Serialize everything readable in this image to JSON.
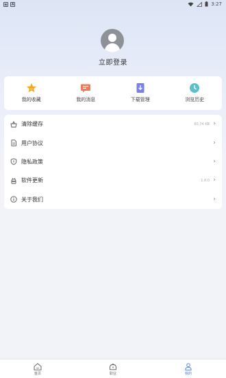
{
  "status_bar": {
    "time": "3:27",
    "left_icons": [
      "notification-icon",
      "a-icon"
    ]
  },
  "profile": {
    "login_label": "立即登录"
  },
  "quick_actions": [
    {
      "label": "我的收藏",
      "icon": "star-icon",
      "color": "#f5a623"
    },
    {
      "label": "我的消息",
      "icon": "message-icon",
      "color": "#ef7a5a"
    },
    {
      "label": "下载管理",
      "icon": "download-icon",
      "color": "#7b7fe8"
    },
    {
      "label": "浏览历史",
      "icon": "history-icon",
      "color": "#5bc0c8"
    }
  ],
  "menu": [
    {
      "label": "清除缓存",
      "icon": "basket-icon",
      "value": "60.74 KB"
    },
    {
      "label": "用户协议",
      "icon": "document-icon",
      "value": ""
    },
    {
      "label": "隐私政策",
      "icon": "shield-icon",
      "value": ""
    },
    {
      "label": "软件更新",
      "icon": "android-icon",
      "value": "1.0.0"
    },
    {
      "label": "关于我们",
      "icon": "info-icon",
      "value": ""
    }
  ],
  "tabs": [
    {
      "label": "首页",
      "icon": "home-icon",
      "active": false
    },
    {
      "label": "职业",
      "icon": "career-icon",
      "active": false
    },
    {
      "label": "我的",
      "icon": "person-icon",
      "active": true
    }
  ],
  "colors": {
    "accent": "#4a7ce0"
  }
}
